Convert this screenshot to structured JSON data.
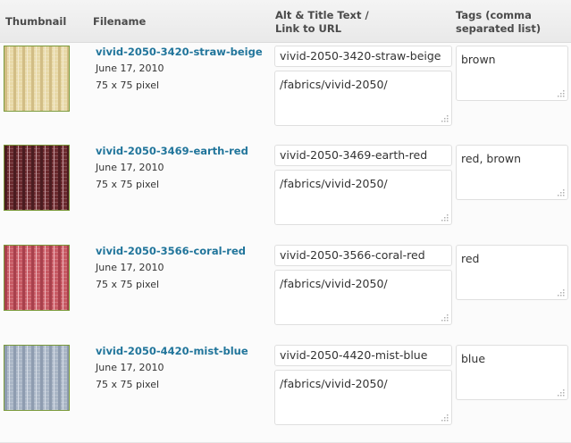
{
  "headers": {
    "thumbnail": "Thumbnail",
    "filename": "Filename",
    "alt_line1": "Alt & Title Text /",
    "alt_line2": "Link to URL",
    "tags_line1": "Tags (comma",
    "tags_line2": "separated list)"
  },
  "rows": [
    {
      "filename": "vivid-2050-3420-straw-beige",
      "date": "June 17, 2010",
      "dimensions": "75 x 75 pixel",
      "alt_text": "vivid-2050-3420-straw-beige",
      "link_url": "/fabrics/vivid-2050/",
      "tags": "brown",
      "swatch": {
        "base": "#e8d9a8",
        "stripe": "#d2bd85",
        "light": "#f3ead0"
      }
    },
    {
      "filename": "vivid-2050-3469-earth-red",
      "date": "June 17, 2010",
      "dimensions": "75 x 75 pixel",
      "alt_text": "vivid-2050-3469-earth-red",
      "link_url": "/fabrics/vivid-2050/",
      "tags": "red, brown",
      "swatch": {
        "base": "#6b2a2e",
        "stripe": "#4a1c20",
        "light": "#c79aa0"
      }
    },
    {
      "filename": "vivid-2050-3566-coral-red",
      "date": "June 17, 2010",
      "dimensions": "75 x 75 pixel",
      "alt_text": "vivid-2050-3566-coral-red",
      "link_url": "/fabrics/vivid-2050/",
      "tags": "red",
      "swatch": {
        "base": "#c85a64",
        "stripe": "#a8404c",
        "light": "#f0b8bf"
      }
    },
    {
      "filename": "vivid-2050-4420-mist-blue",
      "date": "June 17, 2010",
      "dimensions": "75 x 75 pixel",
      "alt_text": "vivid-2050-4420-mist-blue",
      "link_url": "/fabrics/vivid-2050/",
      "tags": "blue",
      "swatch": {
        "base": "#aab6c6",
        "stripe": "#8e9cb0",
        "light": "#d6dde8"
      }
    }
  ]
}
